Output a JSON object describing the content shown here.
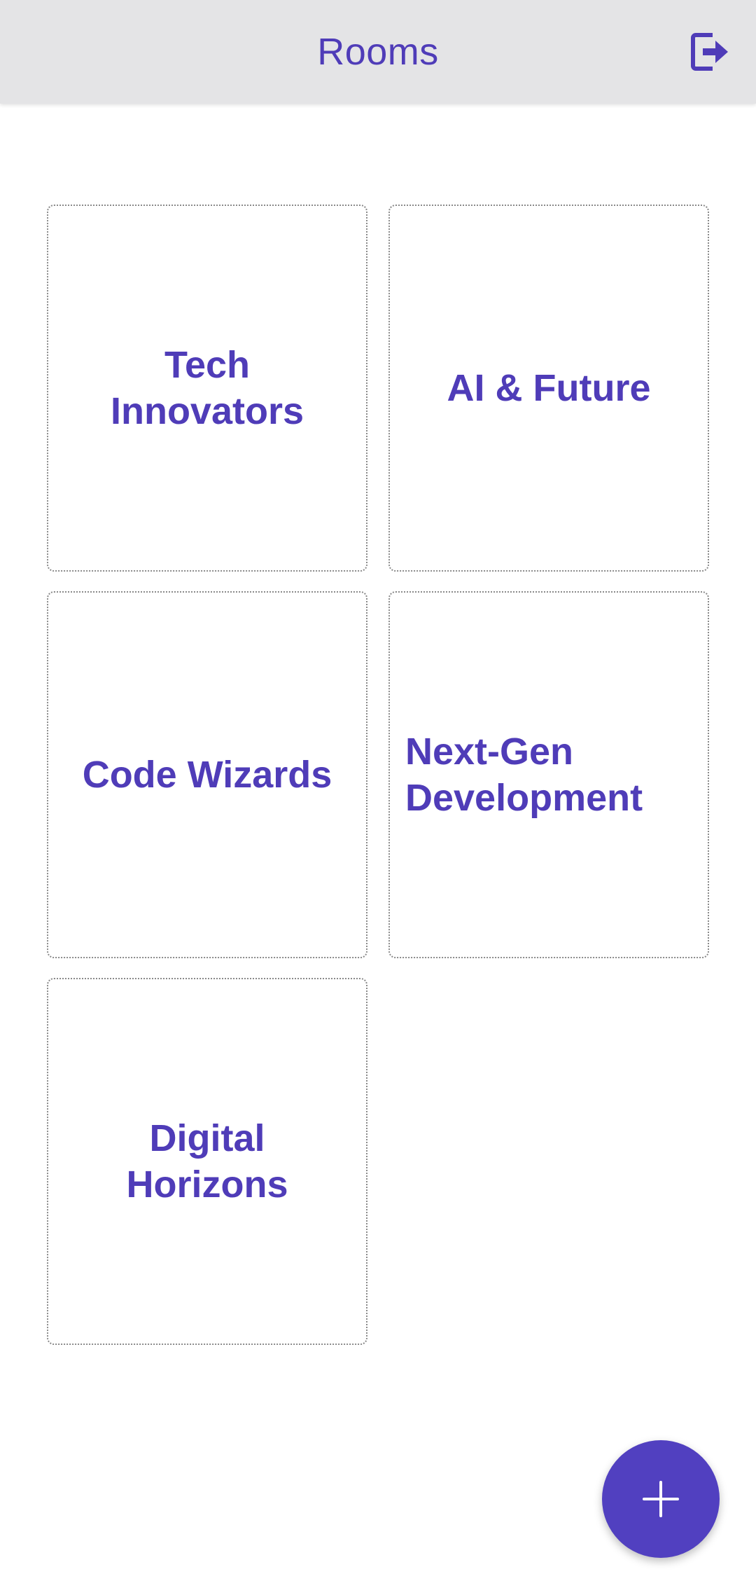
{
  "header": {
    "title": "Rooms",
    "logout_icon": "logout-icon"
  },
  "rooms": [
    {
      "name": "Tech Innovators"
    },
    {
      "name": "AI & Future"
    },
    {
      "name": "Code Wizards"
    },
    {
      "name": "Next-Gen Development"
    },
    {
      "name": "Digital Horizons"
    }
  ],
  "fab": {
    "icon": "plus-icon"
  },
  "colors": {
    "accent": "#4f3cb8",
    "fab_background": "#5140c0",
    "app_bar_background": "#e4e4e6",
    "card_border": "#8a8a8a"
  }
}
